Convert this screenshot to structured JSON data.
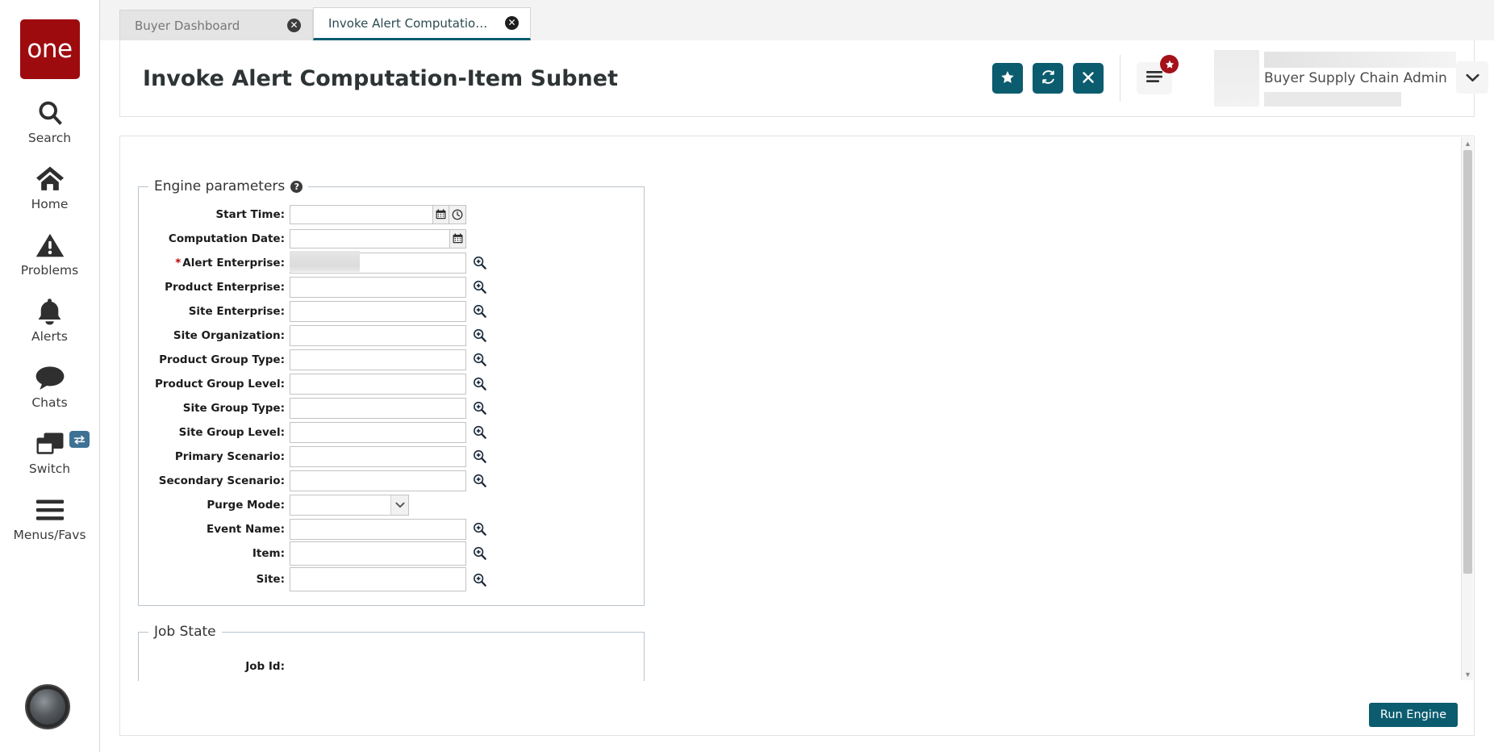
{
  "brand": {
    "logo_text": "one",
    "accent_teal": "#0b5c6e",
    "accent_red": "#9e0b0f",
    "badge_red": "#a41119"
  },
  "sidebar": {
    "items": [
      {
        "label": "Search",
        "icon": "search-icon"
      },
      {
        "label": "Home",
        "icon": "home-icon"
      },
      {
        "label": "Problems",
        "icon": "warning-triangle-icon"
      },
      {
        "label": "Alerts",
        "icon": "bell-icon"
      },
      {
        "label": "Chats",
        "icon": "chat-bubble-icon"
      },
      {
        "label": "Switch",
        "icon": "windows-stack-icon",
        "badge_icon": "swap-arrows-icon"
      },
      {
        "label": "Menus/Favs",
        "icon": "hamburger-icon"
      }
    ]
  },
  "tabs": [
    {
      "label": "Buyer Dashboard",
      "active": false,
      "close_icon": "close-circle-icon"
    },
    {
      "label": "Invoke Alert Computation-Item S...",
      "active": true,
      "close_icon": "close-circle-icon"
    }
  ],
  "header": {
    "title": "Invoke Alert Computation-Item Subnet",
    "actions": [
      {
        "name": "favorite-button",
        "icon": "star-icon"
      },
      {
        "name": "refresh-button",
        "icon": "refresh-icon"
      },
      {
        "name": "close-button",
        "icon": "x-icon"
      }
    ],
    "menu_icon": "hamburger-menu-icon",
    "menu_badge_icon": "star-badge-icon",
    "user_name": "Buyer Supply Chain Admin",
    "user_caret_icon": "chevron-down-icon"
  },
  "engine_panel": {
    "legend": "Engine parameters",
    "help_icon": "question-mark-icon",
    "fields": [
      {
        "label": "Start Time",
        "required": false,
        "value": "",
        "type": "datetime",
        "addons": [
          "calendar-icon",
          "clock-icon"
        ]
      },
      {
        "label": "Computation Date",
        "required": false,
        "value": "",
        "type": "date",
        "addons": [
          "calendar-icon"
        ]
      },
      {
        "label": "Alert Enterprise",
        "required": true,
        "value": "",
        "type": "lookup",
        "lookup_icon": "magnifier-plus-icon",
        "skeleton": true
      },
      {
        "label": "Product Enterprise",
        "required": false,
        "value": "",
        "type": "lookup",
        "lookup_icon": "magnifier-plus-icon"
      },
      {
        "label": "Site Enterprise",
        "required": false,
        "value": "",
        "type": "lookup",
        "lookup_icon": "magnifier-plus-icon"
      },
      {
        "label": "Site Organization",
        "required": false,
        "value": "",
        "type": "lookup",
        "lookup_icon": "magnifier-plus-icon"
      },
      {
        "label": "Product Group Type",
        "required": false,
        "value": "",
        "type": "lookup",
        "lookup_icon": "magnifier-plus-icon"
      },
      {
        "label": "Product Group Level",
        "required": false,
        "value": "",
        "type": "lookup",
        "lookup_icon": "magnifier-plus-icon"
      },
      {
        "label": "Site Group Type",
        "required": false,
        "value": "",
        "type": "lookup",
        "lookup_icon": "magnifier-plus-icon"
      },
      {
        "label": "Site Group Level",
        "required": false,
        "value": "",
        "type": "lookup",
        "lookup_icon": "magnifier-plus-icon"
      },
      {
        "label": "Primary Scenario",
        "required": false,
        "value": "",
        "type": "lookup",
        "lookup_icon": "magnifier-plus-icon"
      },
      {
        "label": "Secondary Scenario",
        "required": false,
        "value": "",
        "type": "lookup",
        "lookup_icon": "magnifier-plus-icon"
      },
      {
        "label": "Purge Mode",
        "required": false,
        "value": "",
        "type": "select",
        "options": [
          ""
        ],
        "caret_icon": "chevron-down-icon"
      },
      {
        "label": "Event Name",
        "required": false,
        "value": "",
        "type": "lookup",
        "lookup_icon": "magnifier-plus-icon"
      },
      {
        "label": "Item",
        "required": false,
        "value": "",
        "type": "lookup",
        "lookup_icon": "magnifier-plus-icon"
      },
      {
        "label": "Site",
        "required": false,
        "value": "",
        "type": "lookup",
        "lookup_icon": "magnifier-plus-icon"
      }
    ]
  },
  "job_state_panel": {
    "legend": "Job State",
    "fields": [
      {
        "label": "Job Id",
        "value": ""
      }
    ]
  },
  "scrollbar": {
    "up_arrow_icon": "caret-up-icon",
    "down_arrow_icon": "caret-down-icon"
  },
  "footer": {
    "run_label": "Run Engine"
  }
}
